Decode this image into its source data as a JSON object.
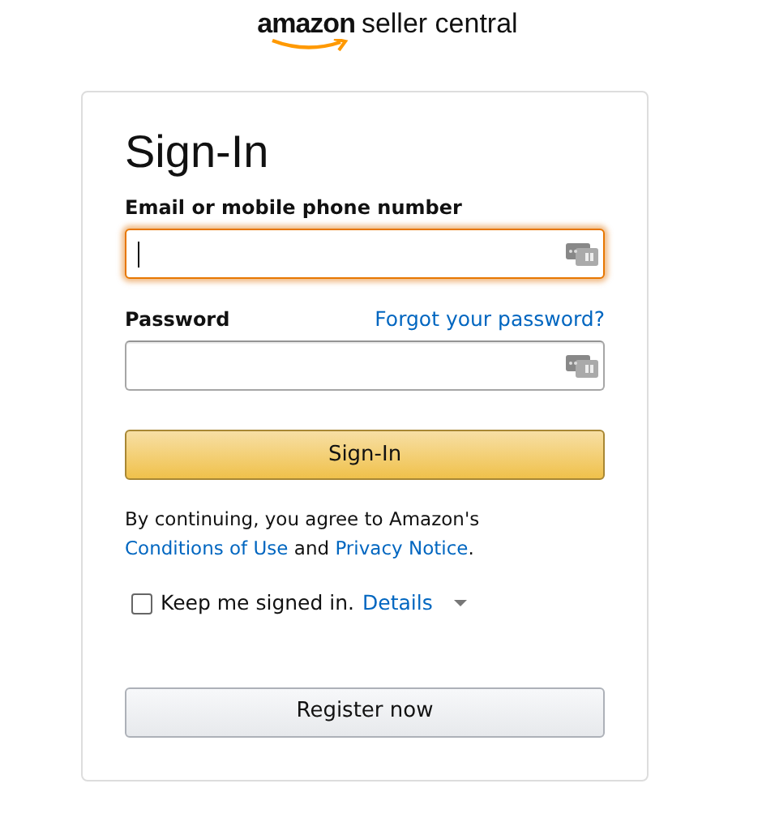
{
  "logo": {
    "brand": "amazon",
    "product": "seller central"
  },
  "title": "Sign-In",
  "fields": [
    {
      "label": "Email or mobile phone number",
      "focused": true
    },
    {
      "label": "Password",
      "focused": false,
      "link": "Forgot your password?"
    }
  ],
  "sign_in_button": "Sign-In",
  "agreement": [
    {
      "kind": "text",
      "text": "By continuing, you agree to Amazon's "
    },
    {
      "kind": "link",
      "text": "Conditions of Use"
    },
    {
      "kind": "text",
      "text": " and "
    },
    {
      "kind": "link",
      "text": "Privacy Notice"
    },
    {
      "kind": "text",
      "text": "."
    }
  ],
  "keep_signed_in": {
    "label": "Keep me signed in.",
    "checked": false,
    "link": "Details"
  },
  "register_button": "Register now"
}
